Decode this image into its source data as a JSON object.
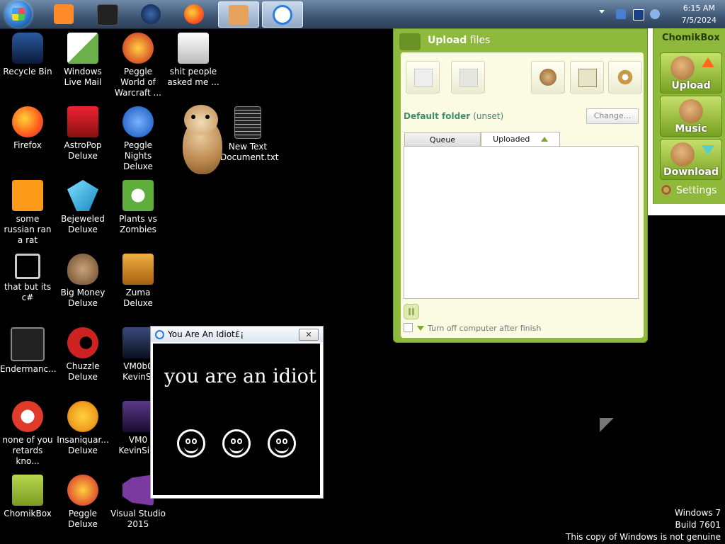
{
  "taskbar": {
    "clock_time": "6:15 AM",
    "clock_date": "7/5/2024",
    "buttons": [
      {
        "name": "media-player",
        "color": "#ff8a2a"
      },
      {
        "name": "black-app",
        "color": "#222222"
      },
      {
        "name": "globe-app",
        "color": "#1a3a7a"
      },
      {
        "name": "firefox",
        "color": "#ff7a1a"
      },
      {
        "name": "chomikbox",
        "color": "#e7a35c"
      },
      {
        "name": "internet-explorer",
        "color": "#2d7be0"
      }
    ]
  },
  "desktop_icons": [
    {
      "label": "Recycle Bin",
      "color": "#1a4d8f"
    },
    {
      "label": "Windows Live Mail",
      "color": "#6bb04a"
    },
    {
      "label": "Peggle World of Warcraft ...",
      "color": "#d8552a"
    },
    {
      "label": "shit people asked me ...",
      "color": "#e6e6e6"
    },
    {
      "label": "Firefox",
      "color": "#ff7a1a"
    },
    {
      "label": "AstroPop Deluxe",
      "color": "#cc2233"
    },
    {
      "label": "Peggle Nights Deluxe",
      "color": "#2e6fcf"
    },
    {
      "label": "New Text Document.txt",
      "color": "#222222"
    },
    {
      "label": "some russian ran a rat",
      "color": "#ff9b1a"
    },
    {
      "label": "Bejeweled Deluxe",
      "color": "#2aa7e0"
    },
    {
      "label": "Plants vs Zombies",
      "color": "#5fae3b"
    },
    {
      "label": "that but its c#",
      "color": "#cccccc"
    },
    {
      "label": "Big Money Deluxe",
      "color": "#9a7a5a"
    },
    {
      "label": "Zuma Deluxe",
      "color": "#e8a23a"
    },
    {
      "label": "Endermanc...",
      "color": "#333333"
    },
    {
      "label": "Chuzzle Deluxe",
      "color": "#cc2222"
    },
    {
      "label": "VM0b0 KevinSi",
      "color": "#3a4a7a"
    },
    {
      "label": "none of you retards kno...",
      "color": "#e03a2a"
    },
    {
      "label": "Insaniquar... Deluxe",
      "color": "#f0a020"
    },
    {
      "label": "VM0 KevinSi...",
      "color": "#5a3a8a"
    },
    {
      "label": "ChomikBox",
      "color": "#8fb93a"
    },
    {
      "label": "Peggle Deluxe",
      "color": "#e05530"
    },
    {
      "label": "Visual Studio 2015",
      "color": "#7a3aa0"
    }
  ],
  "upload_window": {
    "title_bold": "Upload",
    "title_rest": " files",
    "default_folder_label": "Default folder",
    "default_folder_value": "(unset)",
    "change_button": "Change...",
    "tabs": [
      "Queue",
      "Uploaded"
    ],
    "shutdown_label": "Turn off computer after finish"
  },
  "sidebar": {
    "title": "ChomikBox",
    "buttons": [
      "Upload",
      "Music",
      "Download"
    ],
    "settings_label": "Settings"
  },
  "idiot_window": {
    "title": "You Are An Idiot£¡",
    "close_glyph": "✕",
    "message": "you are an idiot"
  },
  "watermark": {
    "line1": "Windows 7",
    "line2": "Build 7601",
    "line3": "This copy of Windows is not genuine"
  }
}
